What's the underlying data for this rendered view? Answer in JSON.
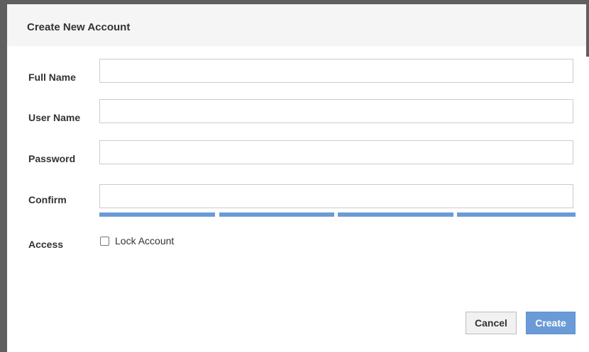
{
  "dialog": {
    "title": "Create New Account"
  },
  "form": {
    "full_name": {
      "label": "Full Name",
      "value": ""
    },
    "user_name": {
      "label": "User Name",
      "value": ""
    },
    "password": {
      "label": "Password",
      "value": ""
    },
    "confirm": {
      "label": "Confirm",
      "value": ""
    },
    "strength_segments": 4,
    "access": {
      "label": "Access",
      "lock_account_label": "Lock Account",
      "lock_account_checked": false
    }
  },
  "buttons": {
    "cancel_label": "Cancel",
    "create_label": "Create"
  },
  "colors": {
    "accent": "#6a9bd6",
    "header_bg": "#f5f5f5",
    "window_border": "#5f5f5f"
  }
}
